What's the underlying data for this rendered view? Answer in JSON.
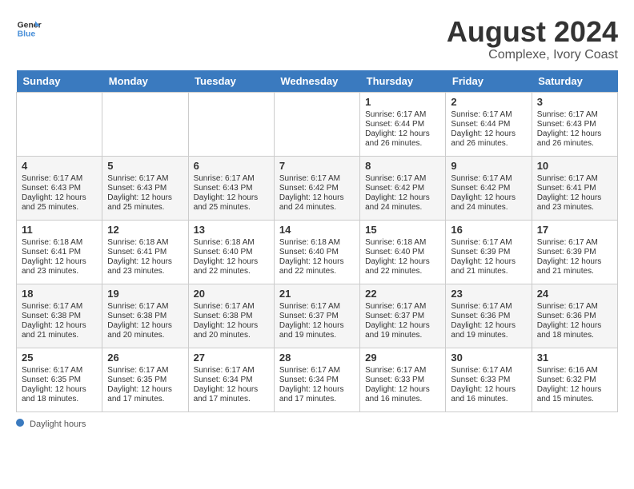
{
  "header": {
    "logo_line1": "General",
    "logo_line2": "Blue",
    "month_year": "August 2024",
    "location": "Complexe, Ivory Coast"
  },
  "days_of_week": [
    "Sunday",
    "Monday",
    "Tuesday",
    "Wednesday",
    "Thursday",
    "Friday",
    "Saturday"
  ],
  "weeks": [
    [
      {
        "day": "",
        "info": ""
      },
      {
        "day": "",
        "info": ""
      },
      {
        "day": "",
        "info": ""
      },
      {
        "day": "",
        "info": ""
      },
      {
        "day": "1",
        "info": "Sunrise: 6:17 AM\nSunset: 6:44 PM\nDaylight: 12 hours and 26 minutes."
      },
      {
        "day": "2",
        "info": "Sunrise: 6:17 AM\nSunset: 6:44 PM\nDaylight: 12 hours and 26 minutes."
      },
      {
        "day": "3",
        "info": "Sunrise: 6:17 AM\nSunset: 6:43 PM\nDaylight: 12 hours and 26 minutes."
      }
    ],
    [
      {
        "day": "4",
        "info": "Sunrise: 6:17 AM\nSunset: 6:43 PM\nDaylight: 12 hours and 25 minutes."
      },
      {
        "day": "5",
        "info": "Sunrise: 6:17 AM\nSunset: 6:43 PM\nDaylight: 12 hours and 25 minutes."
      },
      {
        "day": "6",
        "info": "Sunrise: 6:17 AM\nSunset: 6:43 PM\nDaylight: 12 hours and 25 minutes."
      },
      {
        "day": "7",
        "info": "Sunrise: 6:17 AM\nSunset: 6:42 PM\nDaylight: 12 hours and 24 minutes."
      },
      {
        "day": "8",
        "info": "Sunrise: 6:17 AM\nSunset: 6:42 PM\nDaylight: 12 hours and 24 minutes."
      },
      {
        "day": "9",
        "info": "Sunrise: 6:17 AM\nSunset: 6:42 PM\nDaylight: 12 hours and 24 minutes."
      },
      {
        "day": "10",
        "info": "Sunrise: 6:17 AM\nSunset: 6:41 PM\nDaylight: 12 hours and 23 minutes."
      }
    ],
    [
      {
        "day": "11",
        "info": "Sunrise: 6:18 AM\nSunset: 6:41 PM\nDaylight: 12 hours and 23 minutes."
      },
      {
        "day": "12",
        "info": "Sunrise: 6:18 AM\nSunset: 6:41 PM\nDaylight: 12 hours and 23 minutes."
      },
      {
        "day": "13",
        "info": "Sunrise: 6:18 AM\nSunset: 6:40 PM\nDaylight: 12 hours and 22 minutes."
      },
      {
        "day": "14",
        "info": "Sunrise: 6:18 AM\nSunset: 6:40 PM\nDaylight: 12 hours and 22 minutes."
      },
      {
        "day": "15",
        "info": "Sunrise: 6:18 AM\nSunset: 6:40 PM\nDaylight: 12 hours and 22 minutes."
      },
      {
        "day": "16",
        "info": "Sunrise: 6:17 AM\nSunset: 6:39 PM\nDaylight: 12 hours and 21 minutes."
      },
      {
        "day": "17",
        "info": "Sunrise: 6:17 AM\nSunset: 6:39 PM\nDaylight: 12 hours and 21 minutes."
      }
    ],
    [
      {
        "day": "18",
        "info": "Sunrise: 6:17 AM\nSunset: 6:38 PM\nDaylight: 12 hours and 21 minutes."
      },
      {
        "day": "19",
        "info": "Sunrise: 6:17 AM\nSunset: 6:38 PM\nDaylight: 12 hours and 20 minutes."
      },
      {
        "day": "20",
        "info": "Sunrise: 6:17 AM\nSunset: 6:38 PM\nDaylight: 12 hours and 20 minutes."
      },
      {
        "day": "21",
        "info": "Sunrise: 6:17 AM\nSunset: 6:37 PM\nDaylight: 12 hours and 19 minutes."
      },
      {
        "day": "22",
        "info": "Sunrise: 6:17 AM\nSunset: 6:37 PM\nDaylight: 12 hours and 19 minutes."
      },
      {
        "day": "23",
        "info": "Sunrise: 6:17 AM\nSunset: 6:36 PM\nDaylight: 12 hours and 19 minutes."
      },
      {
        "day": "24",
        "info": "Sunrise: 6:17 AM\nSunset: 6:36 PM\nDaylight: 12 hours and 18 minutes."
      }
    ],
    [
      {
        "day": "25",
        "info": "Sunrise: 6:17 AM\nSunset: 6:35 PM\nDaylight: 12 hours and 18 minutes."
      },
      {
        "day": "26",
        "info": "Sunrise: 6:17 AM\nSunset: 6:35 PM\nDaylight: 12 hours and 17 minutes."
      },
      {
        "day": "27",
        "info": "Sunrise: 6:17 AM\nSunset: 6:34 PM\nDaylight: 12 hours and 17 minutes."
      },
      {
        "day": "28",
        "info": "Sunrise: 6:17 AM\nSunset: 6:34 PM\nDaylight: 12 hours and 17 minutes."
      },
      {
        "day": "29",
        "info": "Sunrise: 6:17 AM\nSunset: 6:33 PM\nDaylight: 12 hours and 16 minutes."
      },
      {
        "day": "30",
        "info": "Sunrise: 6:17 AM\nSunset: 6:33 PM\nDaylight: 12 hours and 16 minutes."
      },
      {
        "day": "31",
        "info": "Sunrise: 6:16 AM\nSunset: 6:32 PM\nDaylight: 12 hours and 15 minutes."
      }
    ]
  ],
  "legend": {
    "daylight_label": "Daylight hours"
  }
}
